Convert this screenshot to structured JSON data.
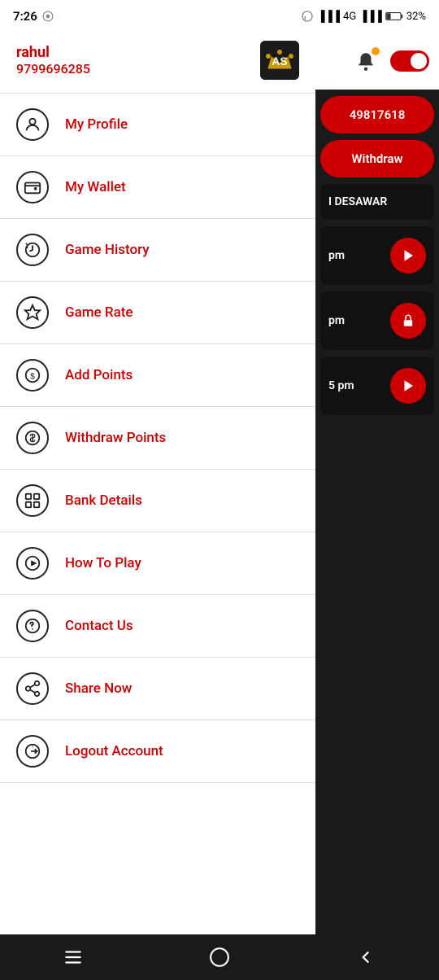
{
  "statusBar": {
    "time": "7:26",
    "battery": "32%",
    "network": "4G"
  },
  "drawer": {
    "username": "rahul",
    "phone": "9799696285",
    "menuItems": [
      {
        "id": "my-profile",
        "label": "My Profile",
        "icon": "person"
      },
      {
        "id": "my-wallet",
        "label": "My Wallet",
        "icon": "wallet"
      },
      {
        "id": "game-history",
        "label": "Game History",
        "icon": "history"
      },
      {
        "id": "game-rate",
        "label": "Game Rate",
        "icon": "star"
      },
      {
        "id": "add-points",
        "label": "Add Points",
        "icon": "dollar"
      },
      {
        "id": "withdraw-points",
        "label": "Withdraw Points",
        "icon": "coin"
      },
      {
        "id": "bank-details",
        "label": "Bank Details",
        "icon": "grid"
      },
      {
        "id": "how-to-play",
        "label": "How To Play",
        "icon": "play"
      },
      {
        "id": "contact-us",
        "label": "Contact Us",
        "icon": "phone"
      },
      {
        "id": "share-now",
        "label": "Share Now",
        "icon": "share"
      },
      {
        "id": "logout-account",
        "label": "Logout Account",
        "icon": "logout"
      }
    ]
  },
  "rightPanel": {
    "btn1": "49817618",
    "btn2": "Withdraw",
    "section1": "I DESAWAR",
    "time1": "pm",
    "time2": "pm",
    "time3": "5 pm"
  },
  "bottomNav": {
    "items": [
      "menu",
      "home",
      "back"
    ]
  }
}
